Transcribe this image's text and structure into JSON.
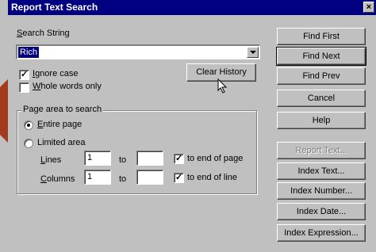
{
  "window": {
    "title": "Report Text Search",
    "close_glyph": "×"
  },
  "search": {
    "label_prefix": "S",
    "label_rest": "earch String",
    "value": "Rich"
  },
  "options": {
    "ignore_case": {
      "label_prefix": "I",
      "label_rest": "gnore case",
      "checked": true
    },
    "whole_words": {
      "label_prefix": "W",
      "label_rest": "hole words only",
      "checked": false
    },
    "clear_history": "Clear History"
  },
  "page_area": {
    "legend": "Page area to search",
    "entire_page": {
      "label_prefix": "E",
      "label_rest": "ntire page",
      "selected": true
    },
    "limited_area": {
      "label": "Limited area",
      "selected": false
    },
    "lines": {
      "label_prefix": "L",
      "label_rest": "ines",
      "from": "1",
      "to_label": "to",
      "to": "",
      "to_end_label": "to end of page",
      "to_end_checked": true
    },
    "columns": {
      "label_prefix": "C",
      "label_rest": "olumns",
      "from": "1",
      "to_label": "to",
      "to": "",
      "to_end_label": "to end of line",
      "to_end_checked": true
    }
  },
  "buttons": {
    "find_first": "Find First",
    "find_next": "Find Next",
    "find_prev": "Find Prev",
    "cancel": "Cancel",
    "help": "Help",
    "report_text": "Report Text...",
    "index_text": "Index Text...",
    "index_number": "Index Number...",
    "index_date": "Index Date...",
    "index_expression": "Index Expression..."
  },
  "colors": {
    "titlebar": "#000080",
    "face": "#c0c0c0",
    "selection": "#000080",
    "background_accent": "#a23a1e"
  }
}
